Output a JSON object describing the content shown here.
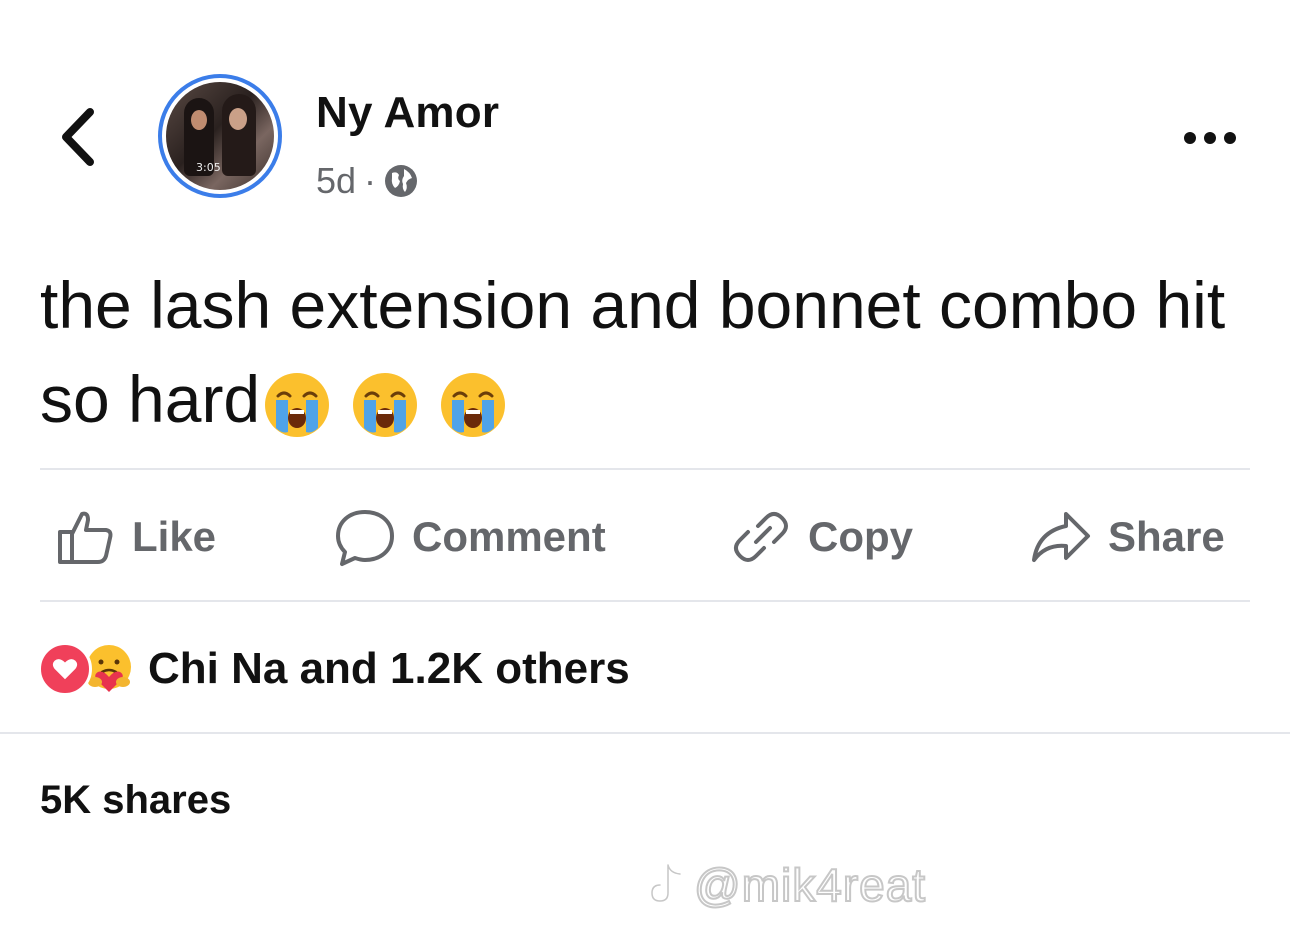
{
  "post": {
    "author": "Ny Amor",
    "time": "5d",
    "separator": "·",
    "avatar_time": "3:05",
    "text": "the lash extension and bonnet combo hit so hard",
    "emojis": [
      "loudly-crying-face",
      "loudly-crying-face",
      "loudly-crying-face"
    ]
  },
  "actions": [
    {
      "label": "Like",
      "icon": "thumbs-up-icon"
    },
    {
      "label": "Comment",
      "icon": "comment-bubble-icon"
    },
    {
      "label": "Copy",
      "icon": "link-icon"
    },
    {
      "label": "Share",
      "icon": "share-arrow-icon"
    }
  ],
  "reactions": {
    "icons": [
      "heart-reaction-icon",
      "care-reaction-icon"
    ],
    "summary": "Chi Na and 1.2K others"
  },
  "shares": "5K shares",
  "watermark": "@mik4reat",
  "colors": {
    "avatar_ring": "#3b7de9",
    "action_gray": "#65676b",
    "divider": "#e4e6eb",
    "heart": "#f0405a"
  }
}
